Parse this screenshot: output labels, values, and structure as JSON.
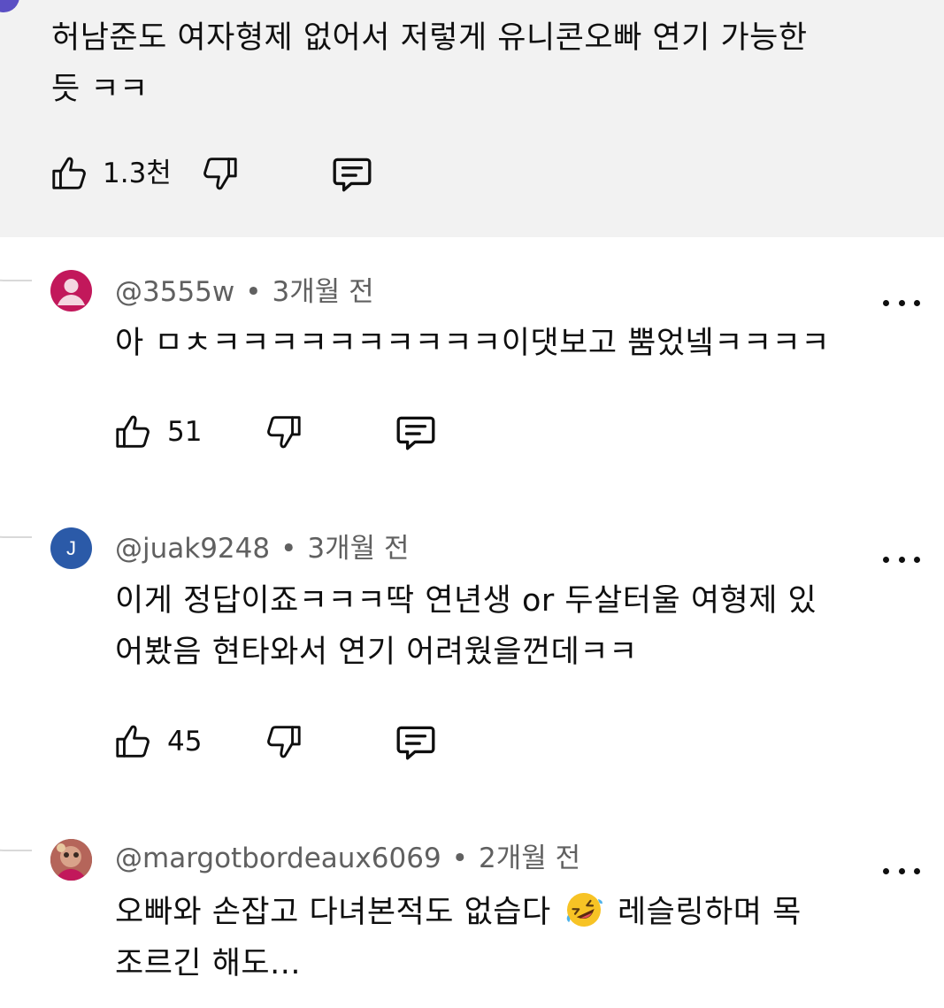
{
  "parent_comment": {
    "text_line1": "허남준도 여자형제 없어서 저렇게 유니콘오빠 연기 가능한",
    "text_line2": "듯 ㅋㅋ",
    "like_count": "1.3천"
  },
  "replies": [
    {
      "handle": "@3555w",
      "separator": "•",
      "time": "3개월 전",
      "text_line1": "아 ㅁㅊㅋㅋㅋㅋㅋㅋㅋㅋㅋㅋ이댓보고 뿜었넼ㅋㅋㅋㅋ",
      "text_line2": "",
      "like_count": "51",
      "avatar_color": "#c2185b"
    },
    {
      "handle": "@juak9248",
      "separator": "•",
      "time": "3개월 전",
      "avatar_letter": "J",
      "text_line1": "이게 정답이죠ㅋㅋㅋ딱 연년생 or 두살터울 여형제 있",
      "text_line2": "어봤음 현타와서 연기 어려웠을껀데ㅋㅋ",
      "like_count": "45",
      "avatar_color": "#2b5aa8"
    },
    {
      "handle": "@margotbordeaux6069",
      "separator": "•",
      "time": "2개월 전",
      "text_line1a": "오빠와 손잡고 다녀본적도 없습다",
      "text_line1b": "레슬링하며 목",
      "text_line2": "조르긴 해도...",
      "avatar_color": "#7a4a3a"
    }
  ],
  "icons": {
    "like": "thumbs-up-icon",
    "dislike": "thumbs-down-icon",
    "reply": "reply-comment-icon",
    "more": "more-options-icon",
    "emoji": "rolling-on-floor-laughing-emoji"
  },
  "colors": {
    "highlight_bg": "#f2f2f2",
    "text": "#0f0f0f",
    "meta_text": "#606060"
  }
}
